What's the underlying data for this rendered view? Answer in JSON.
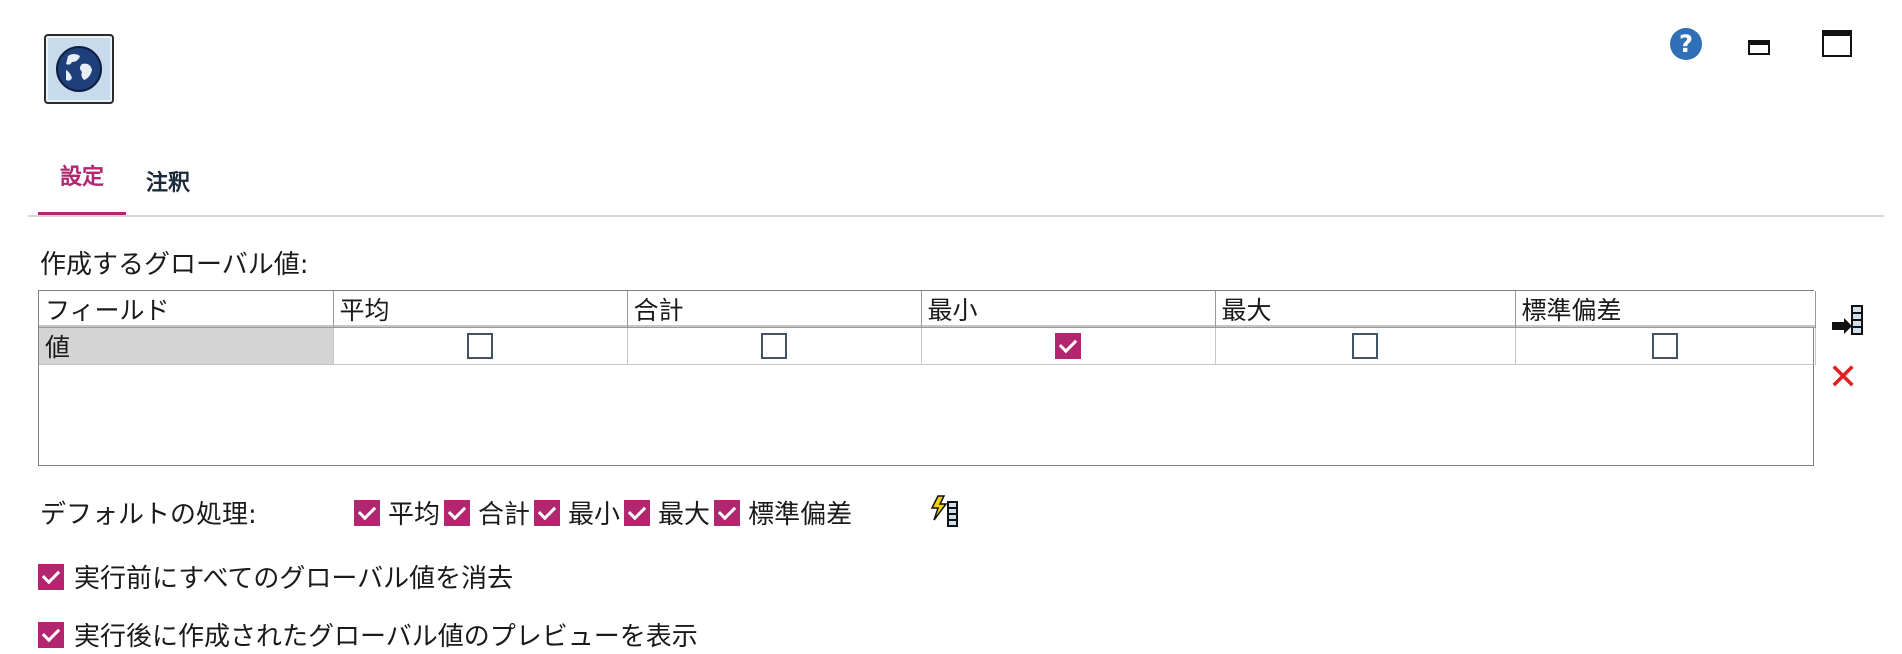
{
  "header": {
    "node_icon": "globe-icon",
    "help_icon": "help-icon",
    "help_symbol": "?",
    "minimize_icon": "minimize-icon",
    "maximize_icon": "maximize-icon"
  },
  "tabs": [
    {
      "label": "設定",
      "active": true
    },
    {
      "label": "注釈",
      "active": false
    }
  ],
  "section_label": "作成するグローバル値:",
  "table": {
    "columns": [
      "フィールド",
      "平均",
      "合計",
      "最小",
      "最大",
      "標準偏差"
    ],
    "rows": [
      {
        "field": "値",
        "mean": false,
        "sum": false,
        "min": true,
        "max": false,
        "sdev": false
      }
    ]
  },
  "toolbar": {
    "add_icon": "add-field-icon",
    "delete_icon": "delete-icon",
    "delete_symbol": "✕"
  },
  "defaults": {
    "label": "デフォルトの処理:",
    "items": [
      {
        "label": "平均",
        "checked": true
      },
      {
        "label": "合計",
        "checked": true
      },
      {
        "label": "最小",
        "checked": true
      },
      {
        "label": "最大",
        "checked": true
      },
      {
        "label": "標準偏差",
        "checked": true
      }
    ],
    "apply_icon": "apply-defaults-icon"
  },
  "options": [
    {
      "label": "実行前にすべてのグローバル値を消去",
      "checked": true
    },
    {
      "label": "実行後に作成されたグローバル値のプレビューを表示",
      "checked": true
    }
  ],
  "colors": {
    "accent": "#b1266f",
    "help": "#2f6fb5",
    "delete": "#e02020"
  }
}
